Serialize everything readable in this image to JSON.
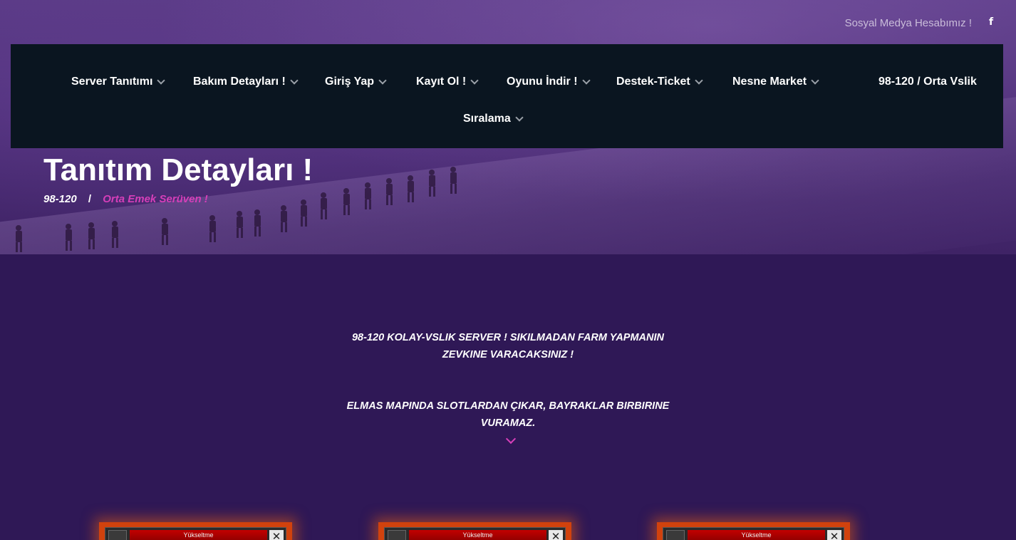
{
  "social": {
    "label": "Sosyal Medya Hesabımız !",
    "icon": "facebook-icon",
    "icon_glyph": "f"
  },
  "nav": {
    "items": [
      {
        "label": "Server Tanıtımı"
      },
      {
        "label": "Bakım Detayları !"
      },
      {
        "label": "Giriş Yap"
      },
      {
        "label": "Kayıt Ol !"
      },
      {
        "label": "Oyunu İndir !"
      },
      {
        "label": "Destek-Ticket"
      },
      {
        "label": "Nesne Market"
      },
      {
        "label": "Sıralama"
      }
    ],
    "brand": "98-120 / Orta Vslik"
  },
  "hero": {
    "title": "Tanıtım Detayları !",
    "breadcrumb": {
      "home": "98-120",
      "separator": "/",
      "current": "Orta Emek Serüven !"
    }
  },
  "intro": {
    "paragraphs": [
      "98-120 KOLAY-VSLIK SERVER ! SIKILMADAN FARM YAPMANIN ZEVKINE VARACAKSINIZ !",
      "ELMAS MAPINDA SLOTLARDAN ÇIKAR, BAYRAKLAR BIRBIRINE VURAMAZ."
    ]
  },
  "cards": [
    {
      "label": "Yükseltme",
      "close": "✕"
    },
    {
      "label": "Yükseltme",
      "close": "✕"
    },
    {
      "label": "Yükseltme",
      "close": "✕"
    }
  ],
  "colors": {
    "accent": "#d63fb9",
    "nav_bg": "#0a1520",
    "page_bg": "#2f1856",
    "card": "#d1420d"
  }
}
